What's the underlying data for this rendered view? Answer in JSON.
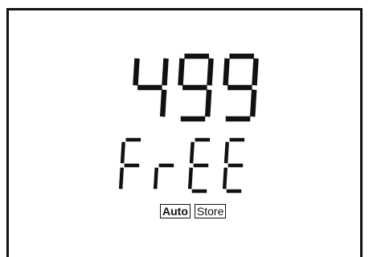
{
  "display": {
    "main_reading": "499",
    "secondary_reading": "FrEE",
    "indicators": [
      {
        "label": "Auto"
      },
      {
        "label": "Store"
      }
    ]
  },
  "colors": {
    "segment": "#111111",
    "background": "#ffffff"
  }
}
